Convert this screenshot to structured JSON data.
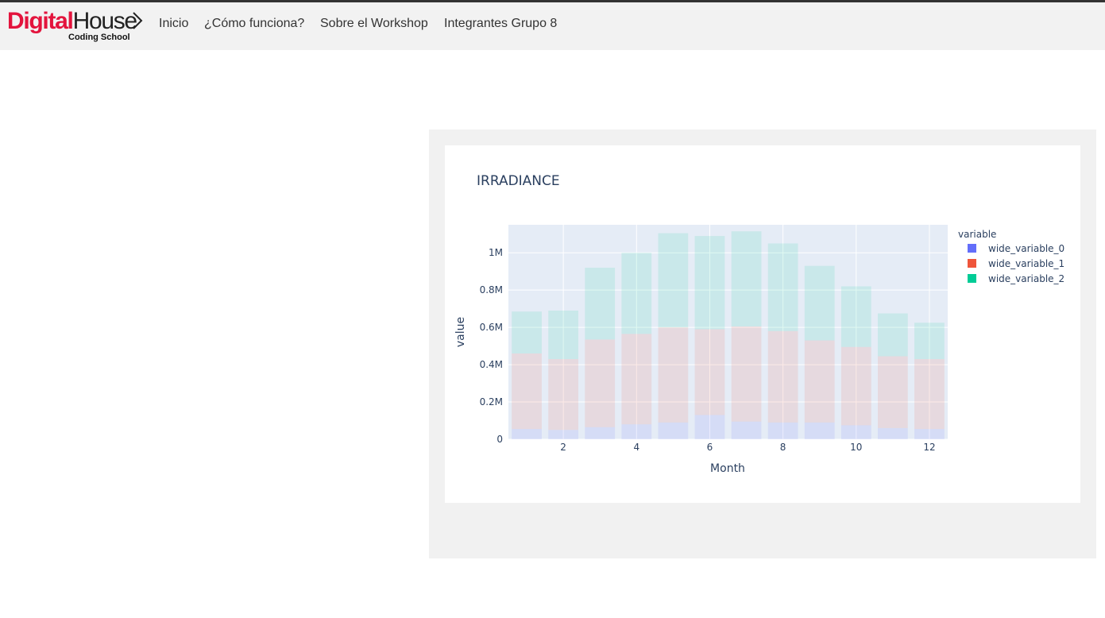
{
  "brand": {
    "name_part1": "Digital",
    "name_part2": "House",
    "subtitle": "Coding School",
    "brand_color": "#e3143d"
  },
  "nav": {
    "items": [
      {
        "label": "Inicio"
      },
      {
        "label": "¿Cómo funciona?"
      },
      {
        "label": "Sobre el Workshop"
      },
      {
        "label": "Integrantes Grupo 8"
      }
    ]
  },
  "chart_data": {
    "type": "bar",
    "stacked": true,
    "title": "IRRADIANCE",
    "xlabel": "Month",
    "ylabel": "value",
    "x": [
      1,
      2,
      3,
      4,
      5,
      6,
      7,
      8,
      9,
      10,
      11,
      12
    ],
    "x_ticks": [
      2,
      4,
      6,
      8,
      10,
      12
    ],
    "y_ticks": [
      0,
      200000,
      400000,
      600000,
      800000,
      1000000
    ],
    "y_tick_labels": [
      "0",
      "0.2M",
      "0.4M",
      "0.6M",
      "0.8M",
      "1M"
    ],
    "ylim": [
      0,
      1150000
    ],
    "grid": true,
    "legend_title": "variable",
    "legend_position": "right",
    "series": [
      {
        "name": "wide_variable_0",
        "color": "#636efa",
        "values": [
          55000,
          50000,
          65000,
          80000,
          90000,
          130000,
          95000,
          90000,
          90000,
          75000,
          60000,
          55000
        ]
      },
      {
        "name": "wide_variable_1",
        "color": "#ef553b",
        "values": [
          405000,
          380000,
          470000,
          485000,
          510000,
          460000,
          510000,
          490000,
          440000,
          420000,
          385000,
          375000
        ]
      },
      {
        "name": "wide_variable_2",
        "color": "#00cc96",
        "values": [
          225000,
          260000,
          385000,
          435000,
          505000,
          500000,
          510000,
          470000,
          400000,
          325000,
          230000,
          195000
        ]
      }
    ]
  }
}
